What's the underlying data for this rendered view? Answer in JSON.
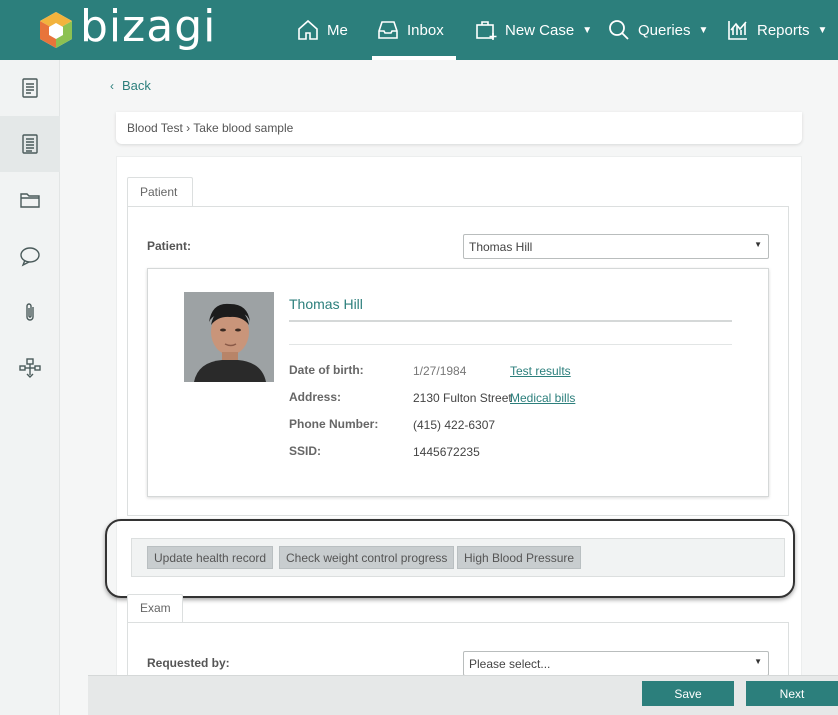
{
  "brand": {
    "name": "bizagi",
    "accent": "#2c7f7c"
  },
  "nav": {
    "items": [
      {
        "label": "Me",
        "icon": "home-icon"
      },
      {
        "label": "Inbox",
        "icon": "inbox-icon",
        "active": true
      },
      {
        "label": "New Case",
        "icon": "new-case-icon"
      },
      {
        "label": "Queries",
        "icon": "search-icon"
      },
      {
        "label": "Reports",
        "icon": "reports-icon"
      }
    ]
  },
  "sidebar": {
    "items": [
      {
        "icon": "document-icon"
      },
      {
        "icon": "task-list-icon",
        "active": true
      },
      {
        "icon": "folder-icon"
      },
      {
        "icon": "comment-icon"
      },
      {
        "icon": "attachment-icon"
      },
      {
        "icon": "workflow-icon"
      }
    ]
  },
  "back_label": "Back",
  "breadcrumb": "Blood Test › Take blood sample",
  "patient_tab": {
    "label": "Patient",
    "field_label": "Patient:",
    "selected": "Thomas Hill"
  },
  "patient": {
    "name": "Thomas Hill",
    "dob_label": "Date of birth:",
    "dob": "1/27/1984",
    "address_label": "Address:",
    "address": "2130 Fulton Street",
    "phone_label": "Phone Number:",
    "phone": "(415) 422-6307",
    "ssid_label": "SSID:",
    "ssid": "1445672235",
    "link_test_results": "Test results",
    "link_medical_bills": "Medical bills"
  },
  "actions": [
    "Update health record",
    "Check weight control progress",
    "High Blood Pressure"
  ],
  "exam_tab": {
    "label": "Exam",
    "field_label": "Requested by:",
    "placeholder": "Please select..."
  },
  "footer": {
    "save_label": "Save",
    "next_label": "Next"
  }
}
